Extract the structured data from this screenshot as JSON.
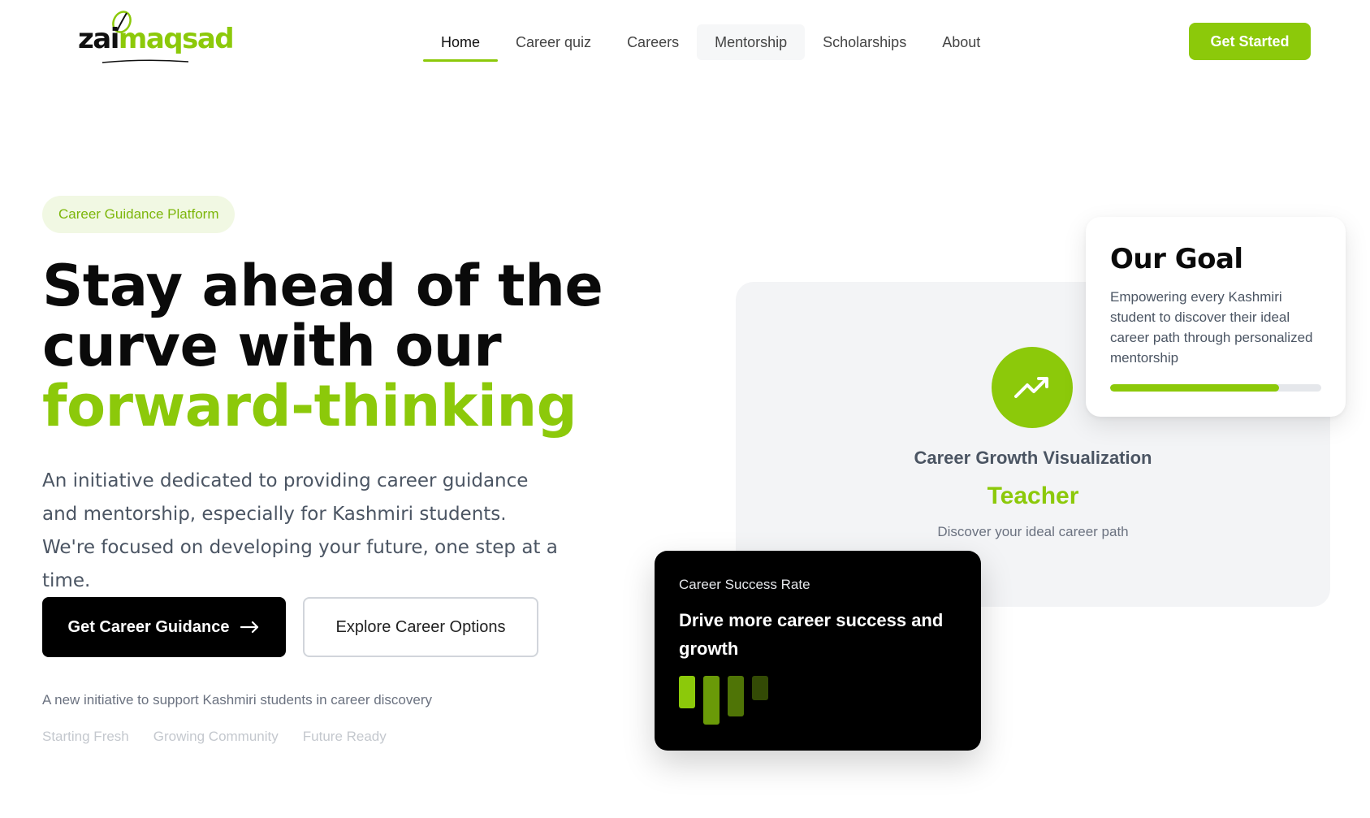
{
  "brand": {
    "part1": "zai",
    "part2": "maqsad",
    "accent": "#8cc90a"
  },
  "nav": {
    "items": [
      {
        "label": "Home"
      },
      {
        "label": "Career quiz"
      },
      {
        "label": "Careers"
      },
      {
        "label": "Mentorship"
      },
      {
        "label": "Scholarships"
      },
      {
        "label": "About"
      }
    ],
    "active": "Home",
    "cta": "Get Started"
  },
  "hero": {
    "badge": "Career Guidance Platform",
    "headline_line1": "Stay ahead of the",
    "headline_line2": "curve with our",
    "headline_accent": "forward-thinking",
    "lead": "An initiative dedicated to providing career guidance and mentorship, especially for Kashmiri students. We're focused on developing your future, one step at a time.",
    "primary_button": "Get Career Guidance",
    "primary_icon": "arrow-right-icon",
    "secondary_button": "Explore Career Options",
    "note": "A new initiative to support Kashmiri students in career discovery",
    "pills": [
      "Starting Fresh",
      "Growing Community",
      "Future Ready"
    ]
  },
  "visual": {
    "icon": "trending-up-icon",
    "title": "Career Growth Visualization",
    "role": "Teacher",
    "subtitle": "Discover your ideal career path"
  },
  "goal": {
    "title": "Our Goal",
    "text": "Empowering every Kashmiri student to discover their ideal career path through personalized mentorship",
    "progress": 0.8
  },
  "success": {
    "label": "Career Success Rate",
    "title": "Drive more career success and growth",
    "bar_colors": [
      "#8cc90a",
      "#6a9a08",
      "#4f7406",
      "#334a05"
    ]
  }
}
